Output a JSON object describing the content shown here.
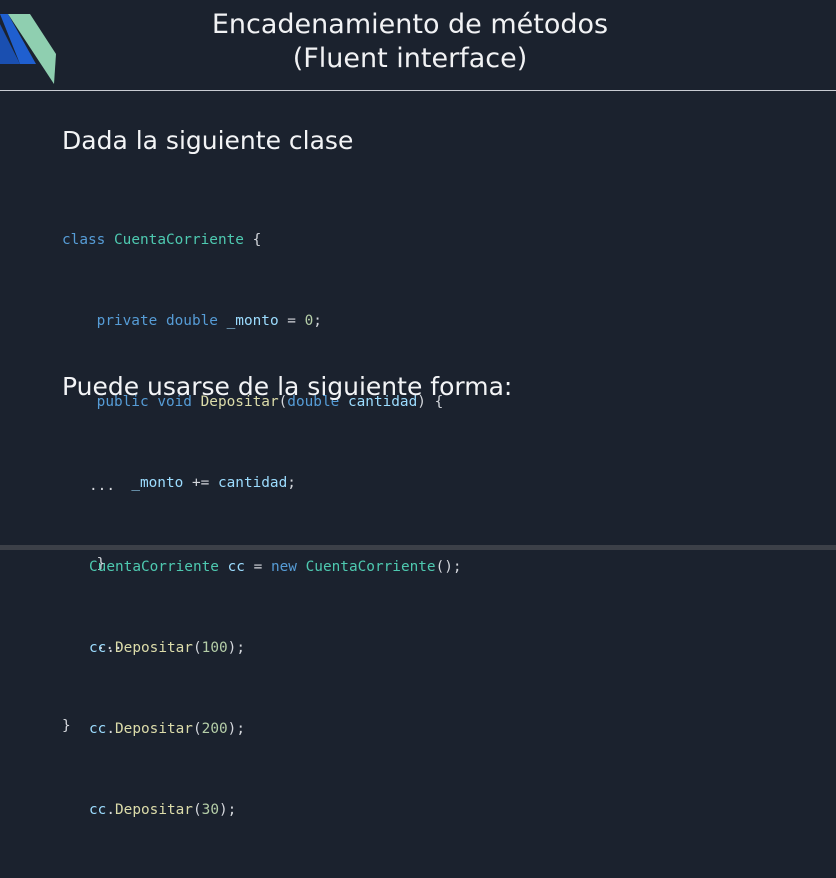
{
  "slide": {
    "title_line1": "Encadenamiento de métodos",
    "title_line2": "(Fluent interface)",
    "heading1": "Dada la siguiente clase",
    "heading2": "Puede usarse de la siguiente forma:"
  },
  "code_block_1": {
    "line1": {
      "kw": "class",
      "type": "CuentaCorriente",
      "rest": " {"
    },
    "line2": {
      "kw1": "private",
      "kw2": "double",
      "field": "_monto",
      "op": " = ",
      "num": "0",
      "end": ";"
    },
    "line3": {
      "kw1": "public",
      "kw2": "void",
      "fn": "Depositar",
      "open": "(",
      "kw3": "double",
      "param": "cantidad",
      "close": ") {"
    },
    "line4": {
      "field": "_monto",
      "op": " += ",
      "param": "cantidad",
      "end": ";"
    },
    "line5": {
      "text": "}"
    },
    "line6": {
      "text": "..."
    },
    "line7": {
      "text": "}"
    }
  },
  "code_block_2": {
    "line1": {
      "text": "..."
    },
    "line2": {
      "type": "CuentaCorriente",
      "var": "cc",
      "op": " = ",
      "kw": "new",
      "ctor": "CuentaCorriente",
      "end": "();"
    },
    "line3": {
      "var": "cc",
      "dot": ".",
      "fn": "Depositar",
      "open": "(",
      "num": "100",
      "close": ");"
    },
    "line4": {
      "var": "cc",
      "dot": ".",
      "fn": "Depositar",
      "open": "(",
      "num": "200",
      "close": ");"
    },
    "line5": {
      "var": "cc",
      "dot": ".",
      "fn": "Depositar",
      "open": "(",
      "num": "30",
      "close": ");"
    }
  },
  "colors": {
    "background": "#1b222e",
    "keyword": "#569cd6",
    "type": "#4ec9b0",
    "function": "#dcdcaa",
    "identifier": "#9cdcfe",
    "number": "#b5cea8",
    "logo_green": "#8fcfb0",
    "logo_blue": "#1f5fcf"
  },
  "icons": {
    "logo": "brand-logo-icon"
  }
}
